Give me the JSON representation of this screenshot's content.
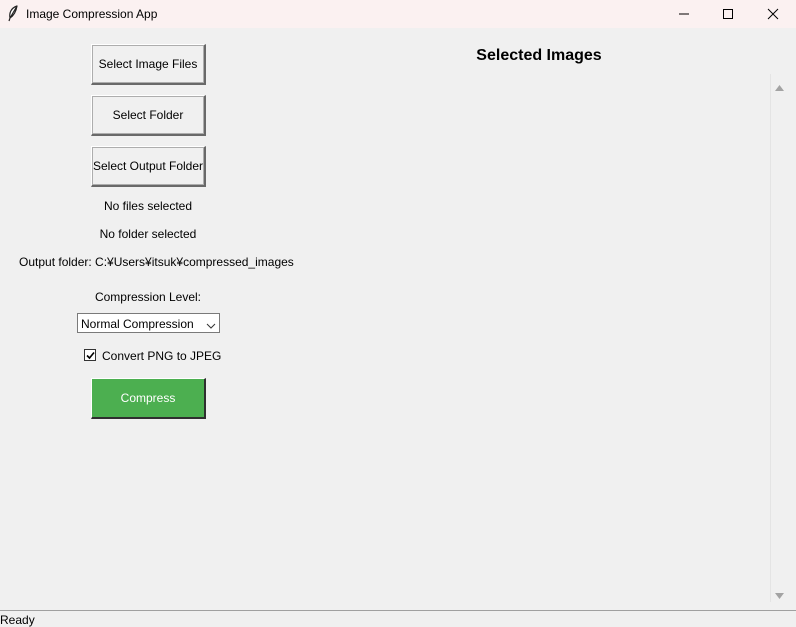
{
  "window": {
    "title": "Image Compression App",
    "icon": "feather-icon",
    "controls": [
      "minimize-icon",
      "maximize-icon",
      "close-icon"
    ]
  },
  "left_panel": {
    "select_files_label": "Select Image Files",
    "select_folder_label": "Select Folder",
    "select_output_label": "Select Output Folder",
    "files_status": "No files selected",
    "folder_status": "No folder selected",
    "output_folder": "Output folder: C:¥Users¥itsuk¥compressed_images",
    "compression_label": "Compression Level:",
    "compression_value": "Normal Compression",
    "convert_label": "Convert PNG to JPEG",
    "convert_checked": true,
    "compress_label": "Compress",
    "compress_color": "#4caf50"
  },
  "right_panel": {
    "heading": "Selected Images"
  },
  "status": {
    "text": "Ready"
  }
}
